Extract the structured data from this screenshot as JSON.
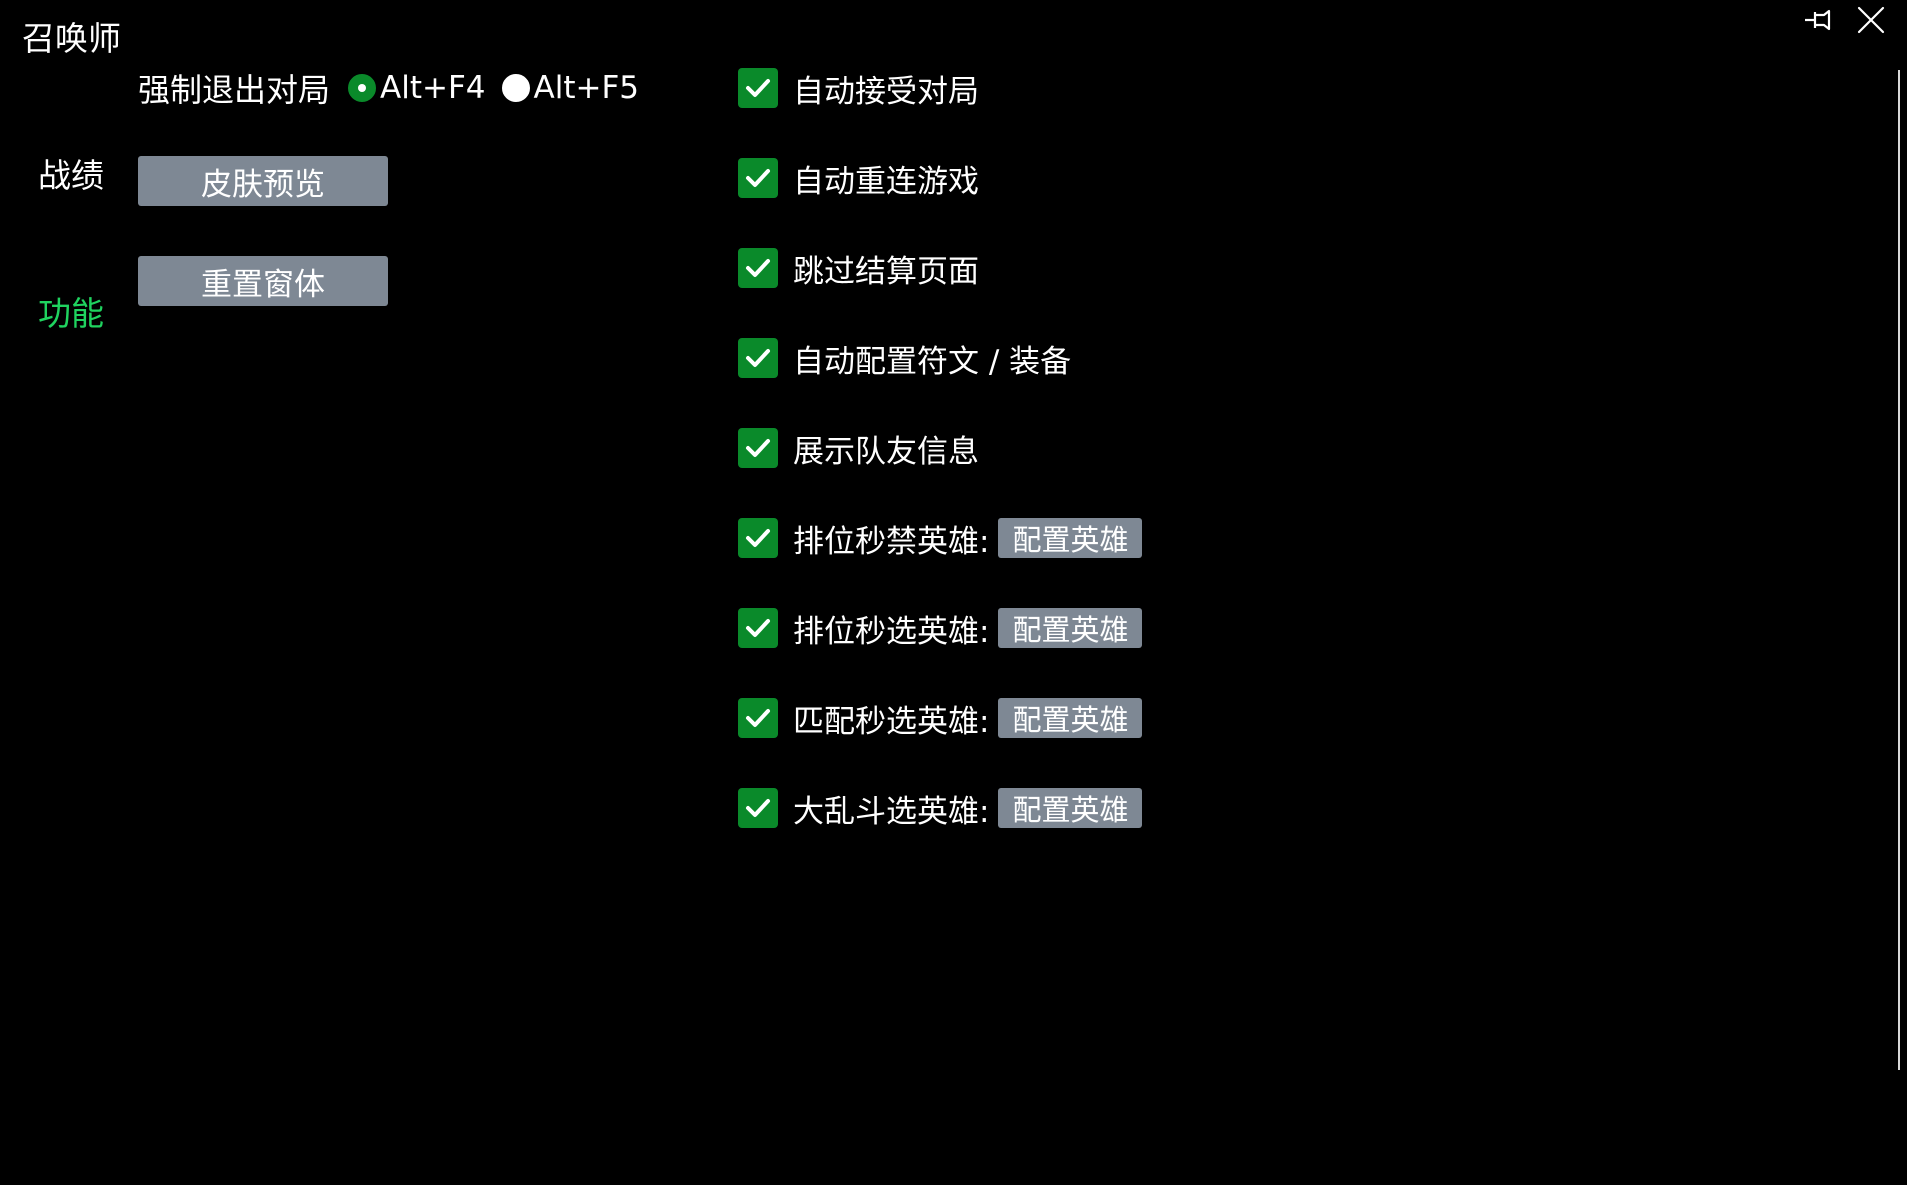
{
  "nav": {
    "summoner": "召唤师",
    "stats": "战绩",
    "features": "功能",
    "active_color": "#1fd35f"
  },
  "window_controls": {
    "pin_icon": "pin-icon",
    "close_icon": "close-icon"
  },
  "force_quit": {
    "label": "强制退出对局",
    "options": [
      {
        "label": "Alt+F4",
        "selected": true
      },
      {
        "label": "Alt+F5",
        "selected": false
      }
    ]
  },
  "buttons": {
    "skin_preview": "皮肤预览",
    "reset_window": "重置窗体"
  },
  "options": [
    {
      "label": "自动接受对局",
      "checked": true
    },
    {
      "label": "自动重连游戏",
      "checked": true
    },
    {
      "label": "跳过结算页面",
      "checked": true
    },
    {
      "label": "自动配置符文 / 装备",
      "checked": true
    },
    {
      "label": "展示队友信息",
      "checked": true
    },
    {
      "label": "排位秒禁英雄:",
      "checked": true,
      "button": "配置英雄"
    },
    {
      "label": "排位秒选英雄:",
      "checked": true,
      "button": "配置英雄"
    },
    {
      "label": "匹配秒选英雄:",
      "checked": true,
      "button": "配置英雄"
    },
    {
      "label": "大乱斗选英雄:",
      "checked": true,
      "button": "配置英雄"
    }
  ],
  "colors": {
    "background": "#000000",
    "checkbox": "#0a8a2a",
    "button": "#7e8894"
  }
}
